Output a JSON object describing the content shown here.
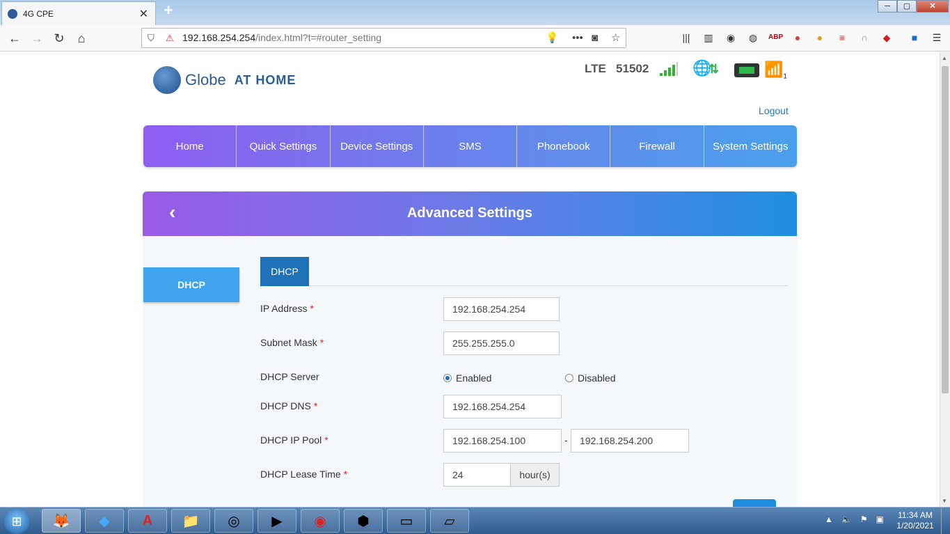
{
  "browser": {
    "tab_title": "4G CPE",
    "tab_close": "✕",
    "new_tab": "+",
    "url_host": "192.168.254.254",
    "url_path": "/index.html?t=#router_setting",
    "window_min": "─",
    "window_max": "▢",
    "window_close": "✕"
  },
  "header_bar": {
    "brand": "Globe",
    "brand_suffix": "AT HOME",
    "network_type": "LTE",
    "network_code": "51502",
    "wifi_clients": "1",
    "logout": "Logout"
  },
  "menu": {
    "items": [
      "Home",
      "Quick Settings",
      "Device Settings",
      "SMS",
      "Phonebook",
      "Firewall",
      "System Settings"
    ]
  },
  "page": {
    "title": "Advanced Settings",
    "back_symbol": "‹",
    "side_tab": "DHCP",
    "sub_tab": "DHCP"
  },
  "form": {
    "ip_address": {
      "label": "IP Address",
      "value": "192.168.254.254"
    },
    "subnet_mask": {
      "label": "Subnet Mask",
      "value": "255.255.255.0"
    },
    "dhcp_server": {
      "label": "DHCP Server",
      "enabled_label": "Enabled",
      "disabled_label": "Disabled",
      "selected": "Enabled"
    },
    "dhcp_dns": {
      "label": "DHCP DNS",
      "value": "192.168.254.254"
    },
    "dhcp_pool": {
      "label": "DHCP IP Pool",
      "start": "192.168.254.100",
      "end": "192.168.254.200",
      "separator": "-"
    },
    "lease_time": {
      "label": "DHCP Lease Time",
      "value": "24",
      "unit": "hour(s)"
    },
    "required_mark": "*"
  },
  "taskbar": {
    "time": "11:34 AM",
    "date": "1/20/2021"
  },
  "colors": {
    "menu_gradient_start": "#8e5df0",
    "menu_gradient_end": "#4aa0ea",
    "accent_blue": "#1f72b8",
    "signal_green": "#34b233",
    "logout_link": "#1a7ad4"
  }
}
